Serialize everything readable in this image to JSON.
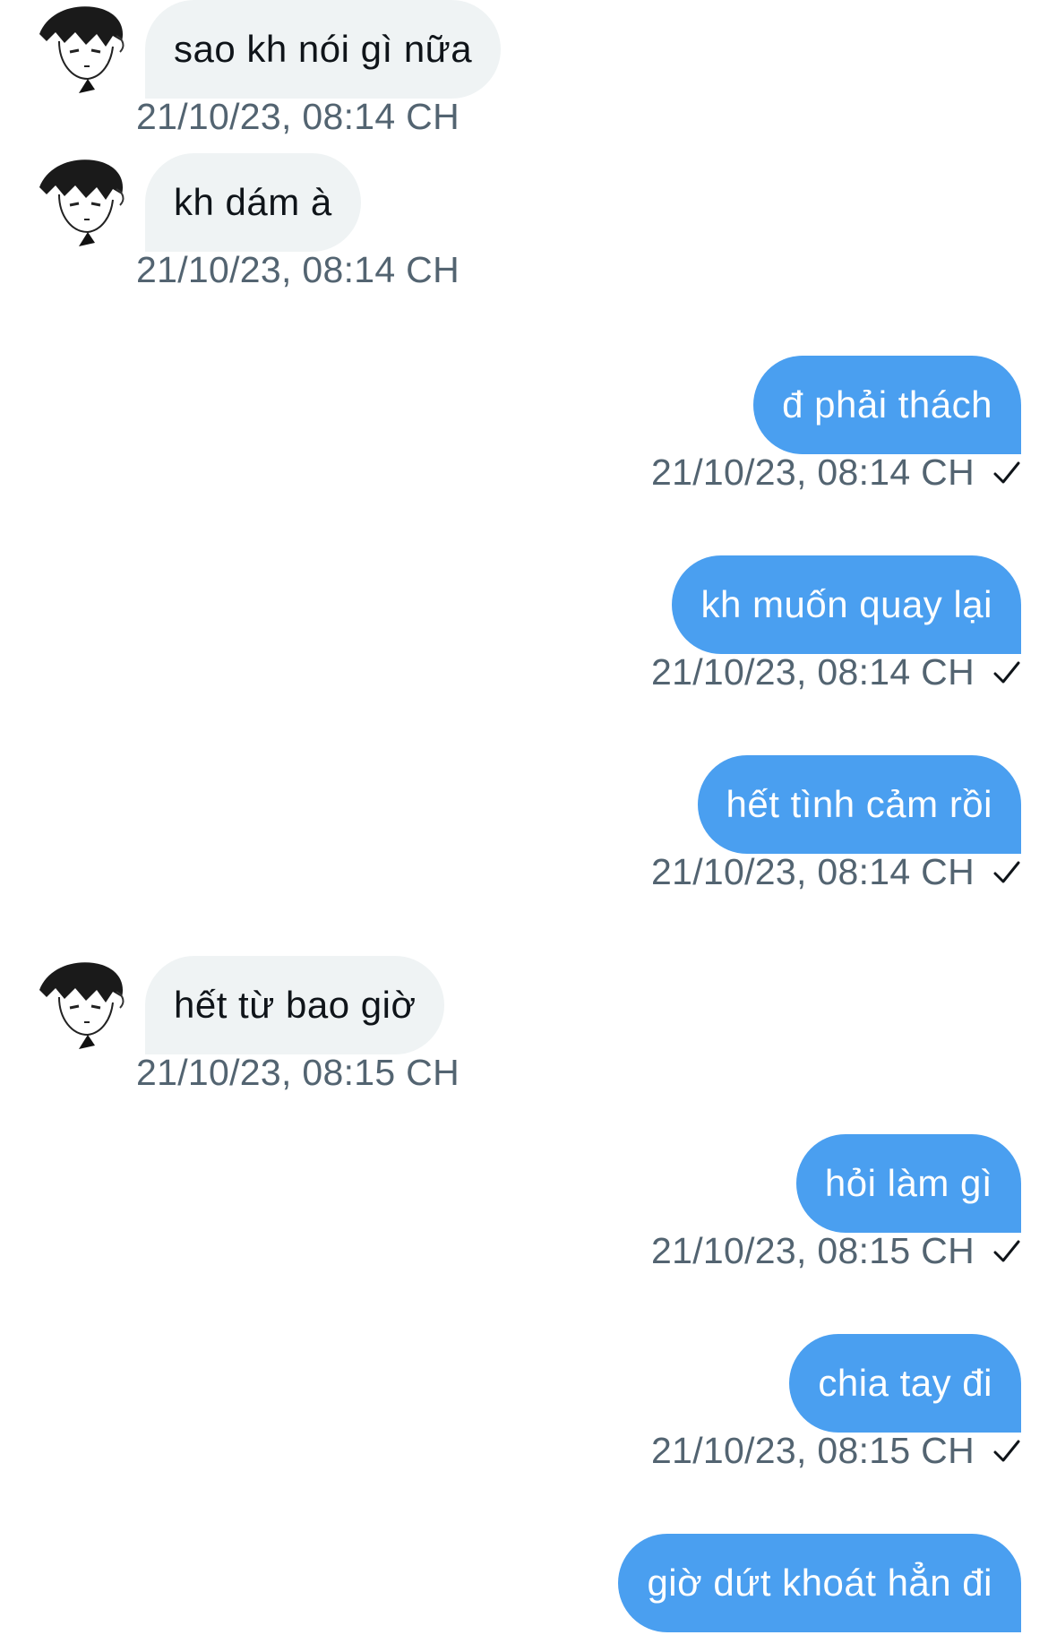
{
  "conversation": {
    "messages": [
      {
        "sender": "them",
        "text": "sao kh nói gì nữa",
        "timestamp": "21/10/23, 08:14 CH"
      },
      {
        "sender": "them",
        "text": "kh dám à",
        "timestamp": "21/10/23, 08:14 CH"
      },
      {
        "sender": "me",
        "text": "đ phải thách",
        "timestamp": "21/10/23, 08:14 CH",
        "status": "sent"
      },
      {
        "sender": "me",
        "text": "kh muốn quay lại",
        "timestamp": "21/10/23, 08:14 CH",
        "status": "sent"
      },
      {
        "sender": "me",
        "text": "hết tình cảm rồi",
        "timestamp": "21/10/23, 08:14 CH",
        "status": "sent"
      },
      {
        "sender": "them",
        "text": "hết từ bao giờ",
        "timestamp": "21/10/23, 08:15 CH"
      },
      {
        "sender": "me",
        "text": "hỏi làm gì",
        "timestamp": "21/10/23, 08:15 CH",
        "status": "sent"
      },
      {
        "sender": "me",
        "text": "chia tay đi",
        "timestamp": "21/10/23, 08:15 CH",
        "status": "sent"
      },
      {
        "sender": "me",
        "text": "giờ dứt khoát hẳn đi",
        "status": "sent"
      }
    ]
  },
  "icons": {
    "sent_status": "checkmark-icon",
    "avatar": "manga-avatar"
  },
  "colors": {
    "outgoing_bubble": "#4a9ff0",
    "incoming_bubble": "#eff3f4",
    "timestamp_text": "#536471",
    "incoming_text": "#0f1419",
    "outgoing_text": "#ffffff"
  }
}
